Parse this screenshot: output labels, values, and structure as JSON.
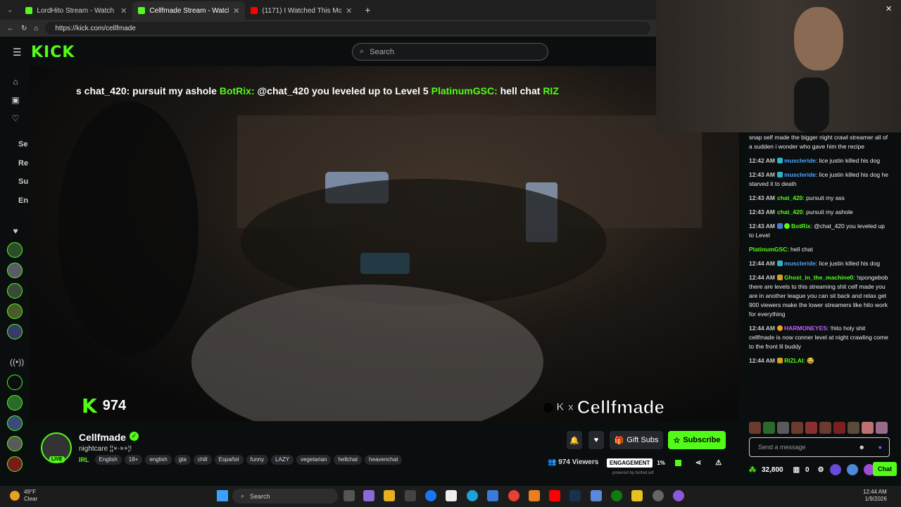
{
  "browser": {
    "tabs": [
      {
        "title": "LordHito Stream - Watch Live",
        "active": false
      },
      {
        "title": "Cellfmade Stream - Watch Live",
        "active": true
      },
      {
        "title": "(1171) I Watched This Movie...",
        "active": false
      }
    ],
    "url": "https://kick.com/cellfmade"
  },
  "header": {
    "logo": "KICK",
    "search_placeholder": "Search"
  },
  "rail": {
    "labels": [
      "Se",
      "Re",
      "Su",
      "En"
    ]
  },
  "video": {
    "ticker_parts": [
      {
        "text": "s chat_420: pursuit my ashole ",
        "green": false
      },
      {
        "text": "BotRix:",
        "green": true
      },
      {
        "text": " @chat_420 you leveled up to Level 5 ",
        "green": false
      },
      {
        "text": "PlatinumGSC:",
        "green": true
      },
      {
        "text": " hell chat ",
        "green": false
      },
      {
        "text": "RIZ",
        "green": false
      }
    ],
    "overlay_viewers": "974",
    "overlay_brand": "Cellfmade"
  },
  "channel": {
    "name": "Cellfmade",
    "title": "nightcare ¦¦×⋅×+¦!",
    "live_label": "LIVE",
    "category": "IRL",
    "tags": [
      "English",
      "18+",
      "english",
      "gta",
      "chill",
      "Español",
      "funny",
      "LAZY",
      "vegetarian",
      "hellchat",
      "heavenchat"
    ],
    "gift_label": "Gift Subs",
    "subscribe_label": "Subscribe",
    "viewers_label": "974 Viewers",
    "engagement_label": "ENGAGEMENT",
    "engagement_value": "1%",
    "powered_by": "powered by botted.wtf"
  },
  "chat": {
    "messages": [
      {
        "time": "",
        "user": "",
        "color": "#ffffff",
        "text": "snap self made the bigger night crawl streamer all of a sudden i wonder who gave him the recipe"
      },
      {
        "time": "12:42 AM",
        "user": "muscleride",
        "color": "#4ea3ff",
        "text": "lice justin killed his dog"
      },
      {
        "time": "12:43 AM",
        "user": "muscleride",
        "color": "#4ea3ff",
        "text": "lice justin killed his dog he starved it to death"
      },
      {
        "time": "12:43 AM",
        "user": "chat_420",
        "color": "#53fc18",
        "text": "pursuit my ass"
      },
      {
        "time": "12:43 AM",
        "user": "chat_420",
        "color": "#53fc18",
        "text": "pursuit my ashole"
      },
      {
        "time": "12:43 AM",
        "user": "BotRix",
        "color": "#53fc18",
        "text": "@chat_420 you leveled up to Level"
      },
      {
        "time": "",
        "user": "PlatinumGSC",
        "color": "#53fc18",
        "text": "hell chat"
      },
      {
        "time": "12:44 AM",
        "user": "muscleride",
        "color": "#4ea3ff",
        "text": "lice justin killed his dog"
      },
      {
        "time": "12:44 AM",
        "user": "Ghost_in_the_machine0",
        "color": "#53fc18",
        "text": "!spongebob there are levels to this streaming shit celf made you are in another league you can sit back and relax get 900 viewers make the lower streamers like hito work for everything"
      },
      {
        "time": "12:44 AM",
        "user": "HARMONEYES",
        "color": "#c061ff",
        "text": "!hito holy shit cellfmade is now conner level at night crawling come to the front lil buddy"
      },
      {
        "time": "12:44 AM",
        "user": "RIZLAI",
        "color": "#53fc18",
        "text": "😂"
      }
    ],
    "input_placeholder": "Send a message",
    "points": "32,800",
    "count": "0",
    "chat_button": "Chat"
  },
  "taskbar": {
    "weather_temp": "49°F",
    "weather_cond": "Clear",
    "search_label": "Search",
    "time": "12:44 AM",
    "date": "1/9/2026"
  }
}
